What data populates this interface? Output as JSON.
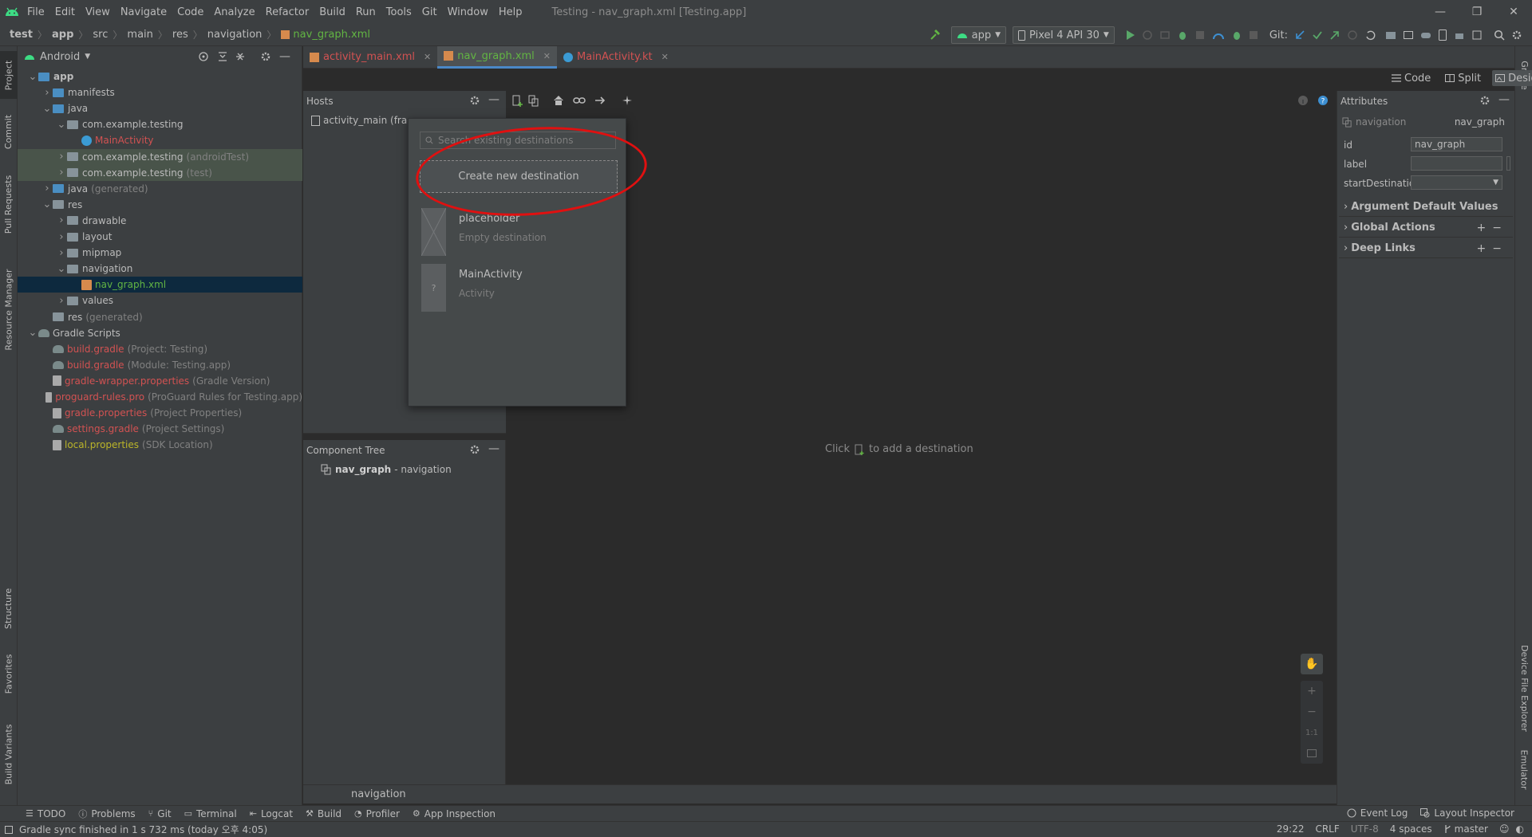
{
  "menubar": {
    "items": [
      "File",
      "Edit",
      "View",
      "Navigate",
      "Code",
      "Analyze",
      "Refactor",
      "Build",
      "Run",
      "Tools",
      "Git",
      "Window",
      "Help"
    ],
    "title": "Testing - nav_graph.xml [Testing.app]"
  },
  "navbar": {
    "breadcrumbs": [
      "test",
      "app",
      "src",
      "main",
      "res",
      "navigation",
      "nav_graph.xml"
    ],
    "run_config": "app",
    "device": "Pixel 4 API 30",
    "git_label": "Git:"
  },
  "left_tabs": [
    "Project",
    "Commit",
    "Pull Requests",
    "Resource Manager",
    "Structure",
    "Favorites",
    "Build Variants"
  ],
  "right_tabs": [
    "Gradle",
    "Device File Explorer",
    "Emulator"
  ],
  "project": {
    "view_mode": "Android",
    "tree": [
      {
        "label": "app",
        "hint": "",
        "indent": 0,
        "arrow": "v",
        "icon": "folder-blue",
        "style": "bold"
      },
      {
        "label": "manifests",
        "hint": "",
        "indent": 1,
        "arrow": ">",
        "icon": "folder-blue",
        "style": ""
      },
      {
        "label": "java",
        "hint": "",
        "indent": 1,
        "arrow": "v",
        "icon": "folder-blue",
        "style": ""
      },
      {
        "label": "com.example.testing",
        "hint": "",
        "indent": 2,
        "arrow": "v",
        "icon": "folder",
        "style": ""
      },
      {
        "label": "MainActivity",
        "hint": "",
        "indent": 3,
        "arrow": "",
        "icon": "kt",
        "style": "red"
      },
      {
        "label": "com.example.testing",
        "hint": "(androidTest)",
        "indent": 2,
        "arrow": ">",
        "icon": "folder",
        "style": "",
        "row": "test"
      },
      {
        "label": "com.example.testing",
        "hint": "(test)",
        "indent": 2,
        "arrow": ">",
        "icon": "folder",
        "style": "",
        "row": "test"
      },
      {
        "label": "java",
        "hint": "(generated)",
        "indent": 1,
        "arrow": ">",
        "icon": "folder-blue",
        "style": ""
      },
      {
        "label": "res",
        "hint": "",
        "indent": 1,
        "arrow": "v",
        "icon": "folder",
        "style": ""
      },
      {
        "label": "drawable",
        "hint": "",
        "indent": 2,
        "arrow": ">",
        "icon": "folder",
        "style": ""
      },
      {
        "label": "layout",
        "hint": "",
        "indent": 2,
        "arrow": ">",
        "icon": "folder",
        "style": ""
      },
      {
        "label": "mipmap",
        "hint": "",
        "indent": 2,
        "arrow": ">",
        "icon": "folder",
        "style": ""
      },
      {
        "label": "navigation",
        "hint": "",
        "indent": 2,
        "arrow": "v",
        "icon": "folder",
        "style": ""
      },
      {
        "label": "nav_graph.xml",
        "hint": "",
        "indent": 3,
        "arrow": "",
        "icon": "xml",
        "style": "green",
        "row": "sel"
      },
      {
        "label": "values",
        "hint": "",
        "indent": 2,
        "arrow": ">",
        "icon": "folder",
        "style": ""
      },
      {
        "label": "res",
        "hint": "(generated)",
        "indent": 1,
        "arrow": "",
        "icon": "folder",
        "style": ""
      },
      {
        "label": "Gradle Scripts",
        "hint": "",
        "indent": 0,
        "arrow": "v",
        "icon": "gradle",
        "style": ""
      },
      {
        "label": "build.gradle",
        "hint": "(Project: Testing)",
        "indent": 1,
        "arrow": "",
        "icon": "gradle",
        "style": "red"
      },
      {
        "label": "build.gradle",
        "hint": "(Module: Testing.app)",
        "indent": 1,
        "arrow": "",
        "icon": "gradle",
        "style": "red"
      },
      {
        "label": "gradle-wrapper.properties",
        "hint": "(Gradle Version)",
        "indent": 1,
        "arrow": "",
        "icon": "file",
        "style": "red"
      },
      {
        "label": "proguard-rules.pro",
        "hint": "(ProGuard Rules for Testing.app)",
        "indent": 1,
        "arrow": "",
        "icon": "file",
        "style": "red"
      },
      {
        "label": "gradle.properties",
        "hint": "(Project Properties)",
        "indent": 1,
        "arrow": "",
        "icon": "file",
        "style": "red"
      },
      {
        "label": "settings.gradle",
        "hint": "(Project Settings)",
        "indent": 1,
        "arrow": "",
        "icon": "gradle",
        "style": "red"
      },
      {
        "label": "local.properties",
        "hint": "(SDK Location)",
        "indent": 1,
        "arrow": "",
        "icon": "file",
        "style": "yellow"
      }
    ]
  },
  "editor_tabs": [
    {
      "label": "activity_main.xml",
      "active": false,
      "color": "#d25252"
    },
    {
      "label": "nav_graph.xml",
      "active": true,
      "color": "#62b543"
    },
    {
      "label": "MainActivity.kt",
      "active": false,
      "color": "#d25252"
    }
  ],
  "view_switch": {
    "code": "Code",
    "split": "Split",
    "design": "Design"
  },
  "hosts": {
    "title": "Hosts",
    "item": "activity_main (fragm"
  },
  "popup": {
    "search_placeholder": "Search existing destinations",
    "create_label": "Create new destination",
    "destinations": [
      {
        "name": "placeholder",
        "type": "Empty destination",
        "thumb": "x"
      },
      {
        "name": "MainActivity",
        "type": "Activity",
        "thumb": "?"
      }
    ]
  },
  "design": {
    "hint_prefix": "Click",
    "hint_suffix": "to add a destination"
  },
  "component_tree": {
    "title": "Component Tree",
    "root_name": "nav_graph",
    "root_type": "- navigation"
  },
  "bottom_nav": {
    "label": "navigation"
  },
  "attributes": {
    "title": "Attributes",
    "type_label": "navigation",
    "type_value": "nav_graph",
    "fields": [
      {
        "label": "id",
        "value": "nav_graph"
      },
      {
        "label": "label",
        "value": ""
      },
      {
        "label": "startDestination",
        "value": ""
      }
    ],
    "sections": [
      "Argument Default Values",
      "Global Actions",
      "Deep Links"
    ]
  },
  "bottom_tabs": [
    "TODO",
    "Problems",
    "Git",
    "Terminal",
    "Logcat",
    "Build",
    "Profiler",
    "App Inspection"
  ],
  "bottom_right_tabs": [
    "Event Log",
    "Layout Inspector"
  ],
  "status": {
    "message": "Gradle sync finished in 1 s 732 ms (today 오후 4:05)",
    "position": "29:22",
    "line_sep": "CRLF",
    "encoding": "UTF-8",
    "indent": "4 spaces",
    "branch": "master"
  },
  "colors": {
    "accent": "#4a88c7",
    "annotation": "#e01010",
    "selection": "#0d293e",
    "android_green": "#3ddc84"
  }
}
